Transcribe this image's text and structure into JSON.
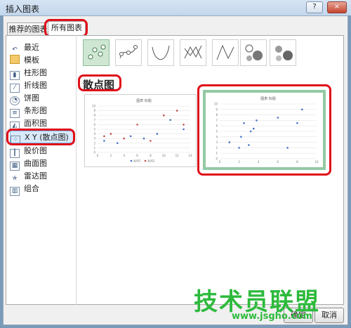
{
  "window": {
    "title": "插入图表",
    "help": "?",
    "close": "×"
  },
  "tabs": [
    {
      "label": "推荐的图表"
    },
    {
      "label": "所有图表"
    }
  ],
  "sidebar": {
    "items": [
      {
        "label": "最近",
        "icon": "undo-icon"
      },
      {
        "label": "模板",
        "icon": "folder-icon"
      },
      {
        "label": "柱形图",
        "icon": "column-chart-icon"
      },
      {
        "label": "折线图",
        "icon": "line-chart-icon"
      },
      {
        "label": "饼图",
        "icon": "pie-chart-icon"
      },
      {
        "label": "条形图",
        "icon": "bar-chart-icon"
      },
      {
        "label": "面积图",
        "icon": "area-chart-icon"
      },
      {
        "label": "X Y (散点图)",
        "icon": "scatter-chart-icon"
      },
      {
        "label": "股价图",
        "icon": "stock-chart-icon"
      },
      {
        "label": "曲面图",
        "icon": "surface-chart-icon"
      },
      {
        "label": "雷达图",
        "icon": "radar-chart-icon"
      },
      {
        "label": "组合",
        "icon": "combo-chart-icon"
      }
    ],
    "selected": "X Y (散点图)"
  },
  "subtypes": [
    "scatter",
    "scatter-smooth-markers",
    "scatter-smooth",
    "scatter-straight-markers",
    "scatter-straight",
    "bubble",
    "bubble-3d"
  ],
  "section_heading": "散点图",
  "previews": [
    {
      "title": "图表 标题",
      "legend": [
        "系列1",
        "系列2"
      ],
      "selected": false
    },
    {
      "title": "图表 标题",
      "selected": true
    }
  ],
  "chart_data": [
    {
      "type": "scatter",
      "title": "图表 标题",
      "xlim": [
        0,
        14
      ],
      "ylim": [
        0,
        10
      ],
      "xticks": [
        "0",
        "2",
        "4",
        "6",
        "8",
        "10",
        "12",
        "14"
      ],
      "yticks": [
        "0",
        "1",
        "2",
        "3",
        "4",
        "5",
        "6",
        "7",
        "8",
        "9",
        "10"
      ],
      "series": [
        {
          "name": "系列1",
          "color": "#4472c4",
          "points": [
            [
              1,
              2.5
            ],
            [
              3,
              2
            ],
            [
              5,
              3.5
            ],
            [
              7,
              3
            ],
            [
              9,
              4
            ],
            [
              11,
              7
            ],
            [
              13,
              5
            ]
          ]
        },
        {
          "name": "系列2",
          "color": "#c0504d",
          "points": [
            [
              1,
              3.5
            ],
            [
              2,
              4
            ],
            [
              4,
              3
            ],
            [
              6,
              6
            ],
            [
              8,
              2.5
            ],
            [
              10,
              8
            ],
            [
              12,
              9
            ],
            [
              13,
              6
            ]
          ]
        }
      ]
    },
    {
      "type": "scatter",
      "title": "图表 标题",
      "xlim": [
        0,
        10
      ],
      "ylim": [
        0,
        10
      ],
      "xticks": [
        "0",
        "2",
        "4",
        "6",
        "8",
        "10"
      ],
      "yticks": [
        "0",
        "1",
        "2",
        "3",
        "4",
        "5",
        "6",
        "7",
        "8",
        "9",
        "10"
      ],
      "series": [
        {
          "color": "#4472c4",
          "points": [
            [
              1,
              3
            ],
            [
              2,
              2
            ],
            [
              2.2,
              4
            ],
            [
              2.5,
              6.5
            ],
            [
              3,
              2.5
            ],
            [
              3.2,
              5
            ],
            [
              3.5,
              5.5
            ],
            [
              3.8,
              7
            ],
            [
              6,
              7.5
            ],
            [
              7,
              2
            ],
            [
              8,
              6.5
            ],
            [
              8.5,
              9
            ]
          ]
        }
      ]
    }
  ],
  "buttons": {
    "ok": "确定",
    "cancel": "取消"
  },
  "watermark": {
    "brand": "技术员联盟",
    "url": "www.jsgho.com"
  }
}
